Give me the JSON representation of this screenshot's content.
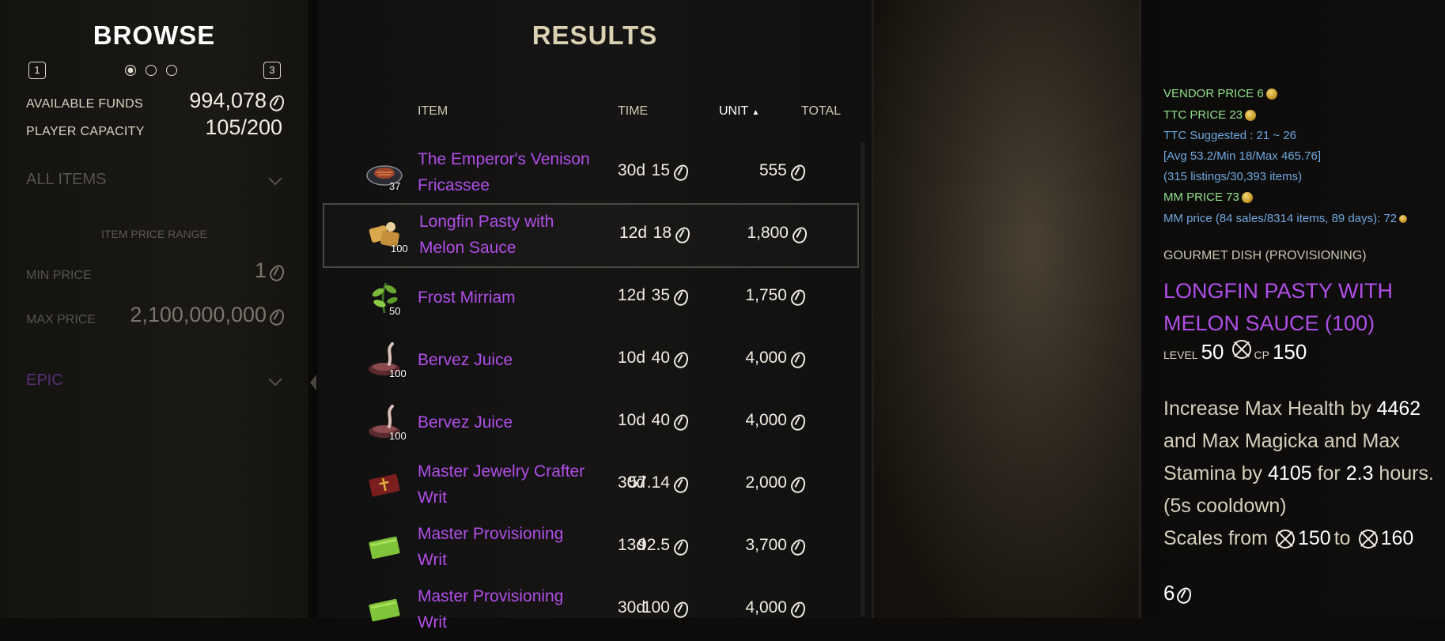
{
  "browse": {
    "title": "BROWSE",
    "key_left": "1",
    "key_right": "3",
    "available_funds_label": "AVAILABLE FUNDS",
    "available_funds_value": "994,078",
    "player_capacity_label": "PLAYER CAPACITY",
    "player_capacity_value": "105/200",
    "category_dropdown": "ALL ITEMS",
    "price_range_title": "ITEM PRICE RANGE",
    "min_price_label": "MIN PRICE",
    "min_price_value": "1",
    "max_price_label": "MAX PRICE",
    "max_price_value": "2,100,000,000",
    "quality_dropdown": "EPIC"
  },
  "results": {
    "title": "RESULTS",
    "columns": {
      "item": "ITEM",
      "time": "TIME",
      "unit": "UNIT",
      "total": "TOTAL"
    },
    "sort_indicator": "▲",
    "rows": [
      {
        "name": "The Emperor's Venison Fricassee",
        "qty": "37",
        "time": "30d",
        "unit": "15",
        "total": "555",
        "icon": "venison-dish-icon"
      },
      {
        "name": "Longfin Pasty with Melon Sauce",
        "qty": "100",
        "time": "12d",
        "unit": "18",
        "total": "1,800",
        "icon": "pasty-dish-icon",
        "selected": true
      },
      {
        "name": "Frost Mirriam",
        "qty": "50",
        "time": "12d",
        "unit": "35",
        "total": "1,750",
        "icon": "herb-icon"
      },
      {
        "name": "Bervez Juice",
        "qty": "100",
        "time": "10d",
        "unit": "40",
        "total": "4,000",
        "icon": "drink-icon"
      },
      {
        "name": "Bervez Juice",
        "qty": "100",
        "time": "10d",
        "unit": "40",
        "total": "4,000",
        "icon": "drink-icon"
      },
      {
        "name": "Master Jewelry Crafter Writ",
        "qty": "",
        "time": "30d",
        "unit": "57.14",
        "total": "2,000",
        "icon": "red-writ-book-icon"
      },
      {
        "name": "Master Provisioning Writ",
        "qty": "",
        "time": "13d",
        "unit": "92.5",
        "total": "3,700",
        "icon": "green-writ-book-icon"
      },
      {
        "name": "Master Provisioning Writ",
        "qty": "",
        "time": "30d",
        "unit": "100",
        "total": "4,000",
        "icon": "green-writ-book-icon"
      }
    ]
  },
  "tooltip": {
    "vendor_price": "VENDOR PRICE 6",
    "ttc_price": "TTC PRICE 23",
    "ttc_suggested": "TTC Suggested : 21 ~ 26",
    "ttc_avg": "[Avg 53.2/Min 18/Max 465.76]",
    "ttc_listings": "(315 listings/30,393 items)",
    "mm_price": "MM PRICE 73",
    "mm_detail": "MM price (84 sales/8314 items, 89 days): 72",
    "category": "GOURMET DISH (PROVISIONING)",
    "item_name": "LONGFIN PASTY WITH MELON SAUCE (100)",
    "level_label": "LEVEL",
    "level_value": "50",
    "cp_label": "CP",
    "cp_value": "150",
    "desc_1": "Increase Max Health by ",
    "desc_health": "4462",
    "desc_2": " and Max Magicka and Max Stamina by ",
    "desc_mag": "4105",
    "desc_3": " for ",
    "desc_dur": "2.3",
    "desc_4": " hours. (5s cooldown)",
    "scales_prefix": "Scales from",
    "scales_from": "150",
    "scales_to_word": "to",
    "scales_to": "160",
    "price": "6"
  },
  "colors": {
    "epic_purple": "#b04ee8",
    "green_text": "#8fe08a",
    "blue_text": "#6fa8e0",
    "gold_header": "#d9d1b2"
  }
}
